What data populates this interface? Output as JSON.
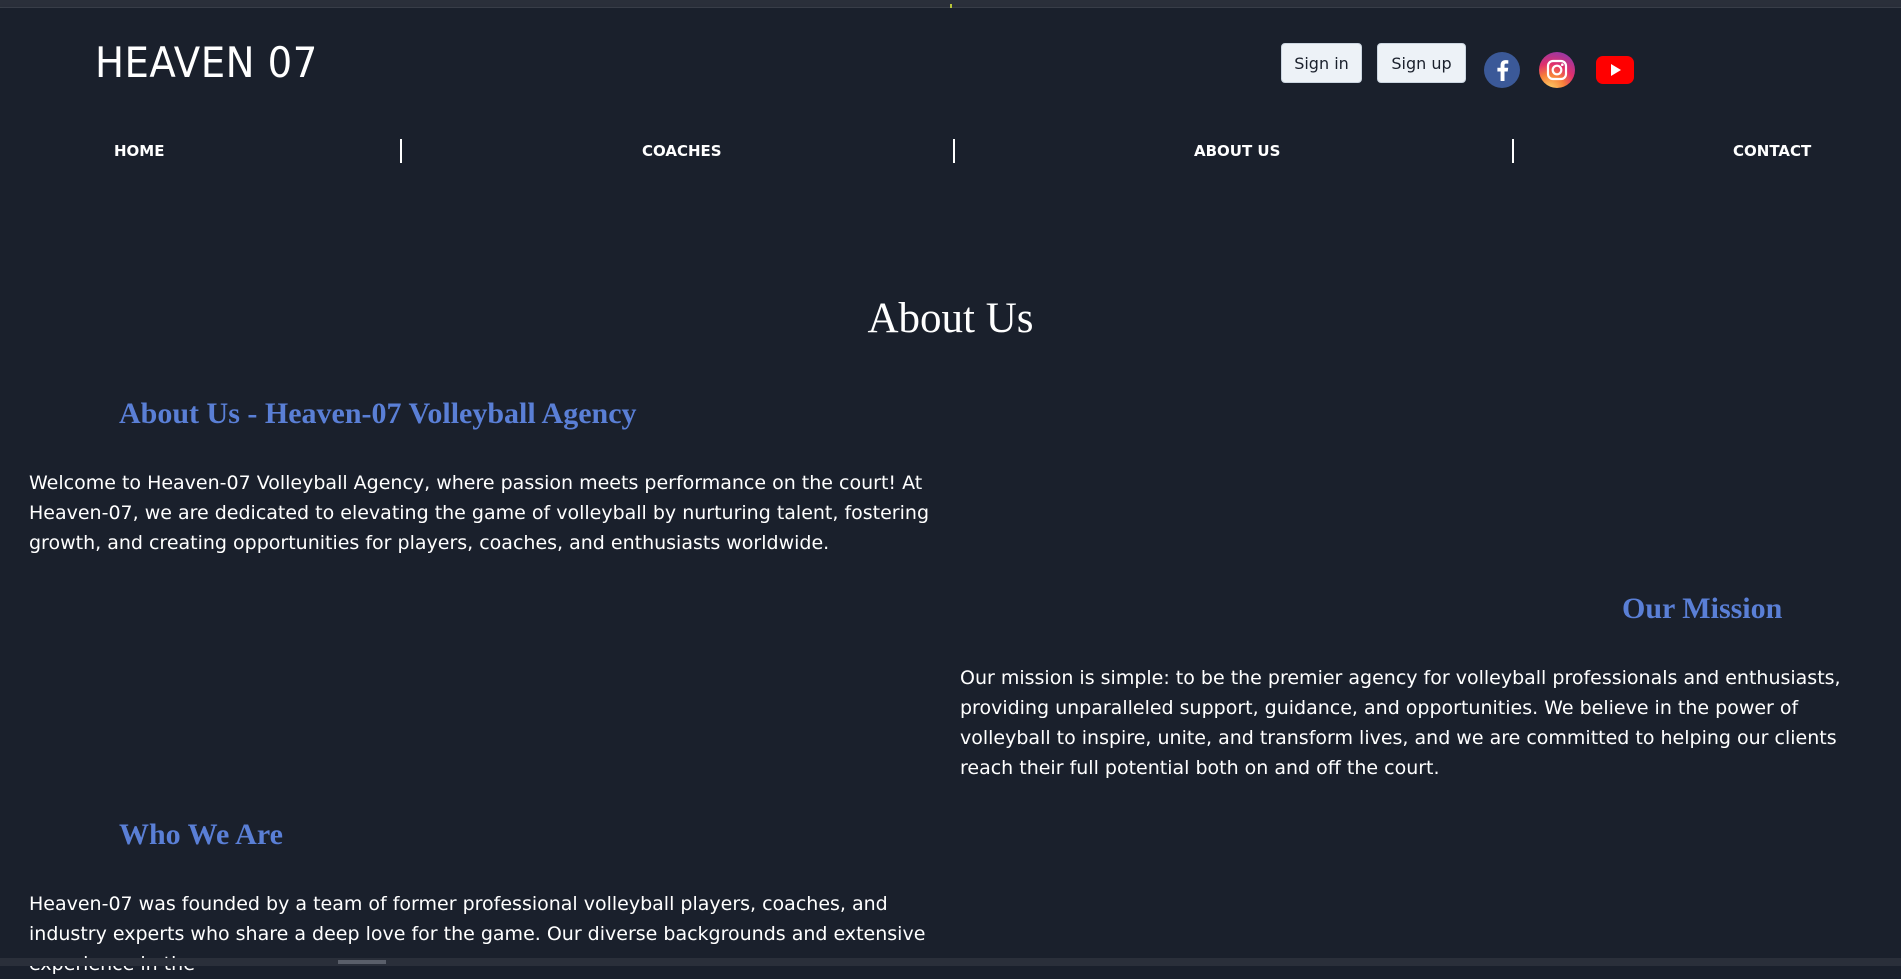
{
  "header": {
    "logo": "HEAVEN 07",
    "sign_in": "Sign in",
    "sign_up": "Sign up",
    "social": [
      {
        "name": "facebook-icon",
        "color": "#3b5998"
      },
      {
        "name": "instagram-icon",
        "color": "#e1306c"
      },
      {
        "name": "youtube-icon",
        "color": "#ff0000"
      }
    ]
  },
  "nav": {
    "home": "HOME",
    "coaches": "COACHES",
    "about": "ABOUT US",
    "contact": "CONTACT"
  },
  "main": {
    "title": "About Us",
    "section1": {
      "heading": "About Us - Heaven-07 Volleyball Agency",
      "text": "Welcome to Heaven-07 Volleyball Agency, where passion meets performance on the court! At Heaven-07, we are dedicated to elevating the game of volleyball by nurturing talent, fostering growth, and creating opportunities for players, coaches, and enthusiasts worldwide."
    },
    "section2": {
      "heading": "Our Mission",
      "text": "Our mission is simple: to be the premier agency for volleyball professionals and enthusiasts, providing unparalleled support, guidance, and opportunities. We believe in the power of volleyball to inspire, unite, and transform lives, and we are committed to helping our clients reach their full potential both on and off the court."
    },
    "section3": {
      "heading": "Who We Are",
      "text": "Heaven-07 was founded by a team of former professional volleyball players, coaches, and industry experts who share a deep love for the game. Our diverse backgrounds and extensive experience in the"
    }
  },
  "colors": {
    "background": "#1a202c",
    "heading_accent": "#5a7fd6",
    "button_bg": "#edf2f7"
  }
}
